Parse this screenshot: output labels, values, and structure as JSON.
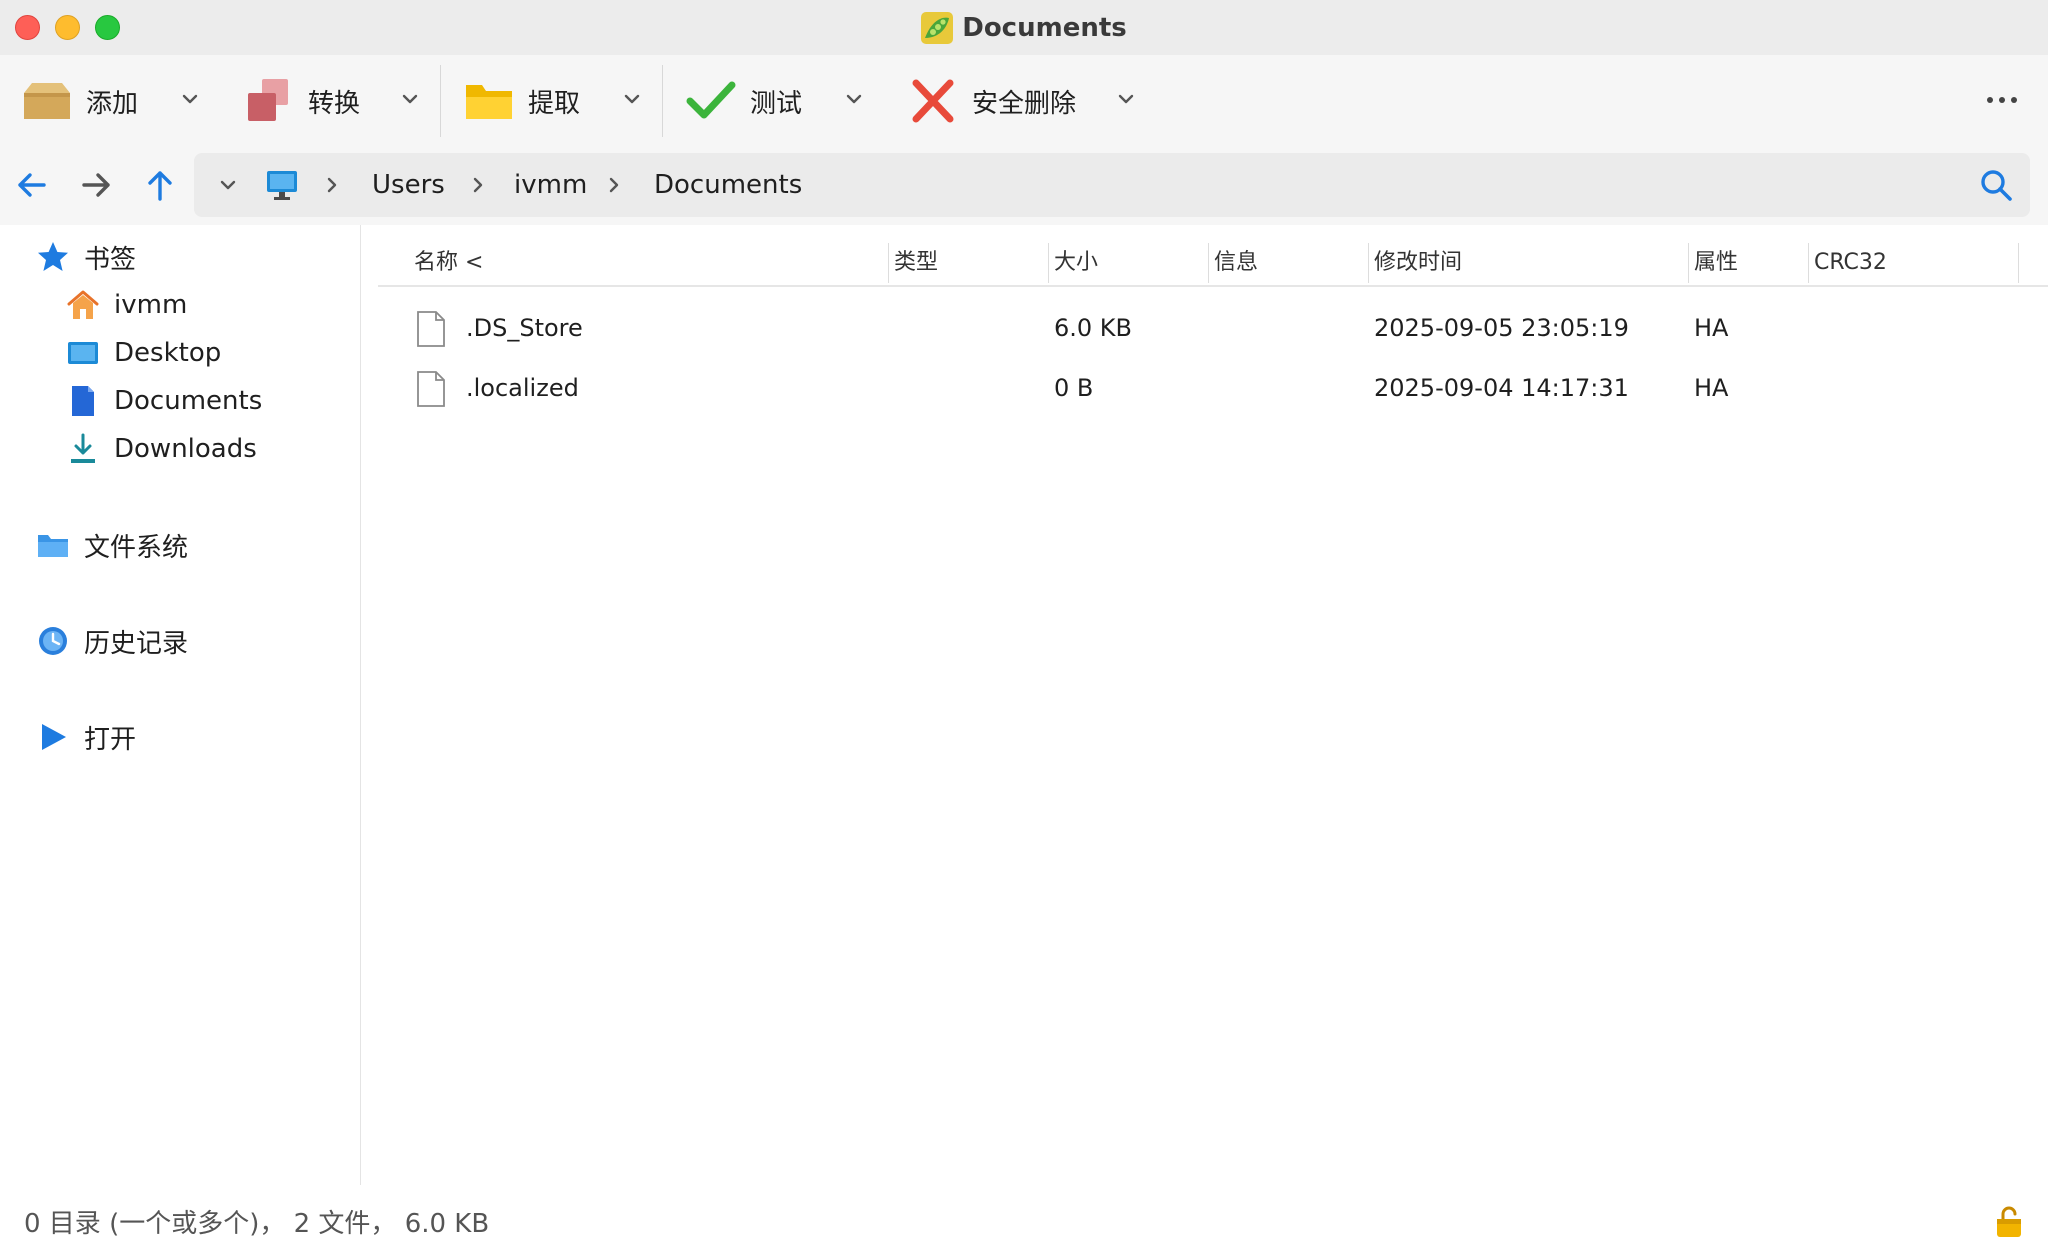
{
  "window": {
    "title": "Documents",
    "app_icon": "pea-pod-app-icon"
  },
  "toolbar": {
    "buttons": [
      {
        "label": "添加",
        "icon": "add-archive-box-icon"
      },
      {
        "label": "转换",
        "icon": "convert-icon"
      },
      {
        "label": "提取",
        "icon": "extract-folder-icon"
      },
      {
        "label": "测试",
        "icon": "test-checkmark-icon"
      },
      {
        "label": "安全删除",
        "icon": "secure-delete-x-icon"
      }
    ],
    "more_icon": "more-ellipsis-icon"
  },
  "nav": {
    "path": [
      "Users",
      "ivmm",
      "Documents"
    ],
    "root_icon": "computer-icon",
    "search_icon": "search-icon"
  },
  "sidebar": {
    "bookmarks_label": "书签",
    "bookmarks": [
      {
        "label": "ivmm",
        "icon": "home-icon"
      },
      {
        "label": "Desktop",
        "icon": "desktop-icon"
      },
      {
        "label": "Documents",
        "icon": "documents-icon"
      },
      {
        "label": "Downloads",
        "icon": "downloads-icon"
      }
    ],
    "filesystem_label": "文件系统",
    "history_label": "历史记录",
    "open_label": "打开"
  },
  "table": {
    "columns": {
      "name": "名称 <",
      "type": "类型",
      "size": "大小",
      "info": "信息",
      "modified": "修改时间",
      "attr": "属性",
      "crc": "CRC32"
    },
    "rows": [
      {
        "name": ".DS_Store",
        "type": "",
        "size": "6.0 KB",
        "info": "",
        "modified": "2025-09-05 23:05:19",
        "attr": "HA",
        "crc": ""
      },
      {
        "name": ".localized",
        "type": "",
        "size": "0 B",
        "info": "",
        "modified": "2025-09-04 14:17:31",
        "attr": "HA",
        "crc": ""
      }
    ]
  },
  "status": {
    "text": "0 目录 (一个或多个)， 2 文件， 6.0 KB",
    "lock_icon": "unlocked-padlock-icon"
  },
  "colors": {
    "accent": "#1e7be0",
    "toolbar_bg": "#f6f6f6",
    "pathbar_bg": "#ebebeb"
  }
}
